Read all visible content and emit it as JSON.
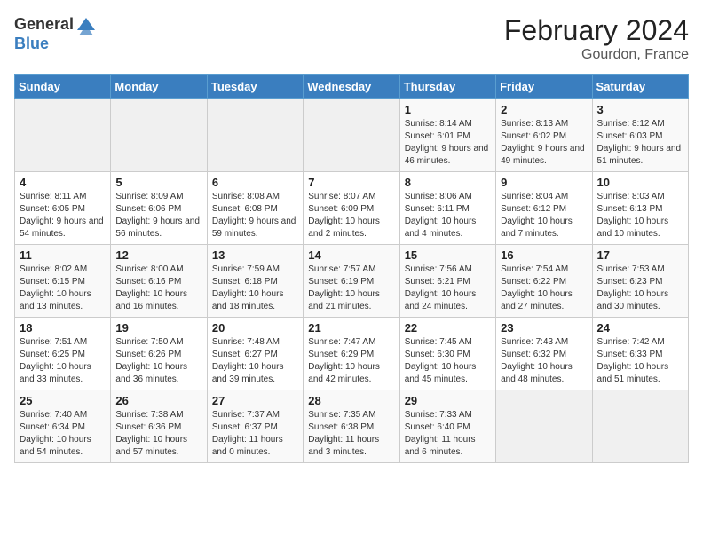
{
  "header": {
    "logo_general": "General",
    "logo_blue": "Blue",
    "title": "February 2024",
    "subtitle": "Gourdon, France"
  },
  "days_of_week": [
    "Sunday",
    "Monday",
    "Tuesday",
    "Wednesday",
    "Thursday",
    "Friday",
    "Saturday"
  ],
  "weeks": [
    [
      {
        "day": "",
        "info": ""
      },
      {
        "day": "",
        "info": ""
      },
      {
        "day": "",
        "info": ""
      },
      {
        "day": "",
        "info": ""
      },
      {
        "day": "1",
        "info": "Sunrise: 8:14 AM\nSunset: 6:01 PM\nDaylight: 9 hours and 46 minutes."
      },
      {
        "day": "2",
        "info": "Sunrise: 8:13 AM\nSunset: 6:02 PM\nDaylight: 9 hours and 49 minutes."
      },
      {
        "day": "3",
        "info": "Sunrise: 8:12 AM\nSunset: 6:03 PM\nDaylight: 9 hours and 51 minutes."
      }
    ],
    [
      {
        "day": "4",
        "info": "Sunrise: 8:11 AM\nSunset: 6:05 PM\nDaylight: 9 hours and 54 minutes."
      },
      {
        "day": "5",
        "info": "Sunrise: 8:09 AM\nSunset: 6:06 PM\nDaylight: 9 hours and 56 minutes."
      },
      {
        "day": "6",
        "info": "Sunrise: 8:08 AM\nSunset: 6:08 PM\nDaylight: 9 hours and 59 minutes."
      },
      {
        "day": "7",
        "info": "Sunrise: 8:07 AM\nSunset: 6:09 PM\nDaylight: 10 hours and 2 minutes."
      },
      {
        "day": "8",
        "info": "Sunrise: 8:06 AM\nSunset: 6:11 PM\nDaylight: 10 hours and 4 minutes."
      },
      {
        "day": "9",
        "info": "Sunrise: 8:04 AM\nSunset: 6:12 PM\nDaylight: 10 hours and 7 minutes."
      },
      {
        "day": "10",
        "info": "Sunrise: 8:03 AM\nSunset: 6:13 PM\nDaylight: 10 hours and 10 minutes."
      }
    ],
    [
      {
        "day": "11",
        "info": "Sunrise: 8:02 AM\nSunset: 6:15 PM\nDaylight: 10 hours and 13 minutes."
      },
      {
        "day": "12",
        "info": "Sunrise: 8:00 AM\nSunset: 6:16 PM\nDaylight: 10 hours and 16 minutes."
      },
      {
        "day": "13",
        "info": "Sunrise: 7:59 AM\nSunset: 6:18 PM\nDaylight: 10 hours and 18 minutes."
      },
      {
        "day": "14",
        "info": "Sunrise: 7:57 AM\nSunset: 6:19 PM\nDaylight: 10 hours and 21 minutes."
      },
      {
        "day": "15",
        "info": "Sunrise: 7:56 AM\nSunset: 6:21 PM\nDaylight: 10 hours and 24 minutes."
      },
      {
        "day": "16",
        "info": "Sunrise: 7:54 AM\nSunset: 6:22 PM\nDaylight: 10 hours and 27 minutes."
      },
      {
        "day": "17",
        "info": "Sunrise: 7:53 AM\nSunset: 6:23 PM\nDaylight: 10 hours and 30 minutes."
      }
    ],
    [
      {
        "day": "18",
        "info": "Sunrise: 7:51 AM\nSunset: 6:25 PM\nDaylight: 10 hours and 33 minutes."
      },
      {
        "day": "19",
        "info": "Sunrise: 7:50 AM\nSunset: 6:26 PM\nDaylight: 10 hours and 36 minutes."
      },
      {
        "day": "20",
        "info": "Sunrise: 7:48 AM\nSunset: 6:27 PM\nDaylight: 10 hours and 39 minutes."
      },
      {
        "day": "21",
        "info": "Sunrise: 7:47 AM\nSunset: 6:29 PM\nDaylight: 10 hours and 42 minutes."
      },
      {
        "day": "22",
        "info": "Sunrise: 7:45 AM\nSunset: 6:30 PM\nDaylight: 10 hours and 45 minutes."
      },
      {
        "day": "23",
        "info": "Sunrise: 7:43 AM\nSunset: 6:32 PM\nDaylight: 10 hours and 48 minutes."
      },
      {
        "day": "24",
        "info": "Sunrise: 7:42 AM\nSunset: 6:33 PM\nDaylight: 10 hours and 51 minutes."
      }
    ],
    [
      {
        "day": "25",
        "info": "Sunrise: 7:40 AM\nSunset: 6:34 PM\nDaylight: 10 hours and 54 minutes."
      },
      {
        "day": "26",
        "info": "Sunrise: 7:38 AM\nSunset: 6:36 PM\nDaylight: 10 hours and 57 minutes."
      },
      {
        "day": "27",
        "info": "Sunrise: 7:37 AM\nSunset: 6:37 PM\nDaylight: 11 hours and 0 minutes."
      },
      {
        "day": "28",
        "info": "Sunrise: 7:35 AM\nSunset: 6:38 PM\nDaylight: 11 hours and 3 minutes."
      },
      {
        "day": "29",
        "info": "Sunrise: 7:33 AM\nSunset: 6:40 PM\nDaylight: 11 hours and 6 minutes."
      },
      {
        "day": "",
        "info": ""
      },
      {
        "day": "",
        "info": ""
      }
    ]
  ]
}
